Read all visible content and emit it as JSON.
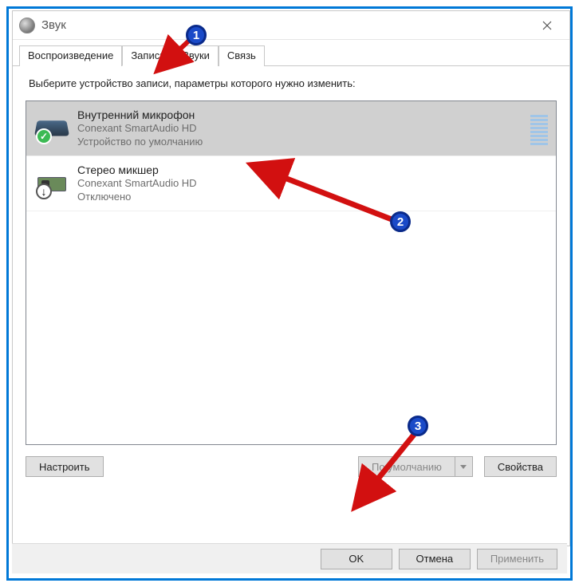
{
  "window": {
    "title": "Звук"
  },
  "tabs": {
    "playback": "Воспроизведение",
    "recording": "Запись",
    "sounds": "Звуки",
    "communications": "Связь"
  },
  "instruction": "Выберите устройство записи, параметры которого нужно изменить:",
  "devices": [
    {
      "name": "Внутренний микрофон",
      "driver": "Conexant SmartAudio HD",
      "status": "Устройство по умолчанию"
    },
    {
      "name": "Стерео микшер",
      "driver": "Conexant SmartAudio HD",
      "status": "Отключено"
    }
  ],
  "buttons": {
    "configure": "Настроить",
    "set_default": "По умолчанию",
    "properties": "Свойства",
    "ok": "OK",
    "cancel": "Отмена",
    "apply": "Применить"
  },
  "annotations": {
    "a1": "1",
    "a2": "2",
    "a3": "3"
  }
}
